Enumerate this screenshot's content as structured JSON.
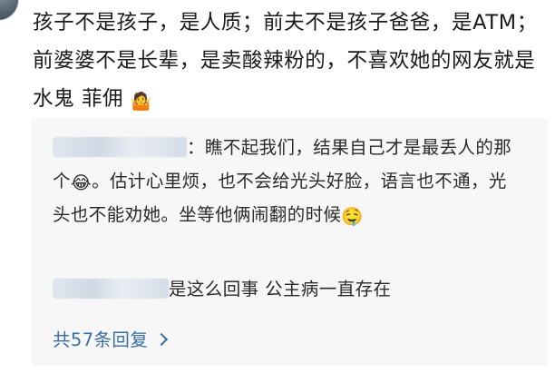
{
  "post": {
    "text": "孩子不是孩子，是人质；前夫不是孩子爸爸，是ATM；前婆婆不是长辈，是卖酸辣粉的，不喜欢她的网友就是水鬼 菲佣",
    "trailing_emoji": "🤷",
    "trailing_emoji_name": "shrug-emoji"
  },
  "replies": [
    {
      "author": "[blurred username]",
      "text_before_emoji": "：瞧不起我们，结果自己才是最丢人的那个",
      "emoji_1": "😂",
      "emoji_1_name": "tears-of-joy-emoji",
      "text_after_emoji": "。估计心里烦，也不会给光头好脸，语言也不通，光头也不能劝她。坐等他俩闹翻的时候",
      "emoji_2": "🤤",
      "emoji_2_name": "drooling-emoji"
    },
    {
      "author": "[blurred username]",
      "text": "是这么回事 公主病一直存在"
    }
  ],
  "more_replies": {
    "label": "共57条回复"
  },
  "colors": {
    "link": "#3a6ea5",
    "reply_background": "#f7f7f7",
    "text": "#1a1a1a"
  }
}
